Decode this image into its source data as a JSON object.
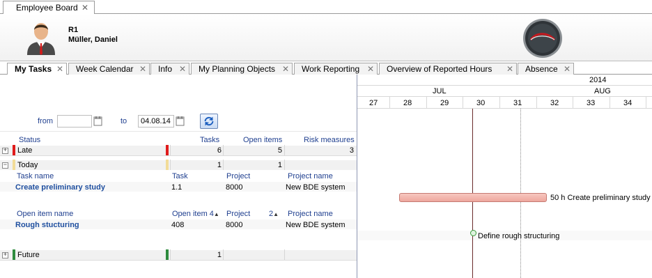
{
  "document_tab": {
    "label": "Employee Board",
    "close": "✕"
  },
  "user": {
    "code": "R1",
    "name": "Müller, Daniel"
  },
  "tabs": [
    {
      "label": "My Tasks",
      "active": true,
      "close": "✕"
    },
    {
      "label": "Week Calendar",
      "close": "✕"
    },
    {
      "label": "Info",
      "close": "✕"
    },
    {
      "label": "My Planning Objects",
      "close": "✕"
    },
    {
      "label": "Work Reporting",
      "close": "✕"
    },
    {
      "label": "Overview of Reported Hours",
      "close": "✕"
    },
    {
      "label": "Absence",
      "close": "✕"
    }
  ],
  "filter": {
    "from_label": "from",
    "from_value": "",
    "to_label": "to",
    "to_value": "04.08.14"
  },
  "summary_headers": {
    "status": "Status",
    "tasks": "Tasks",
    "open_items": "Open items",
    "risk": "Risk measures"
  },
  "groups": {
    "late": {
      "label": "Late",
      "tasks": "6",
      "open_items": "5",
      "risk": "3",
      "color": "#e01b1b",
      "expander": "+"
    },
    "today": {
      "label": "Today",
      "tasks": "1",
      "open_items": "1",
      "risk": "",
      "color": "#f2dc98",
      "expander": "−"
    },
    "future": {
      "label": "Future",
      "tasks": "1",
      "open_items": "",
      "risk": "",
      "color": "#2e8b3e",
      "expander": "+"
    }
  },
  "task_table": {
    "headers": {
      "name": "Task name",
      "task": "Task",
      "project": "Project",
      "project_name": "Project name"
    },
    "rows": [
      {
        "name": "Create preliminary study",
        "task": "1.1",
        "project": "8000",
        "project_name": "New BDE system"
      }
    ]
  },
  "open_item_table": {
    "headers": {
      "name": "Open item name",
      "item": "Open item 4",
      "project": "Project",
      "sort2": "2",
      "project_name": "Project name"
    },
    "sort_arrow": "▲",
    "rows": [
      {
        "name": "Rough stucturing",
        "item": "408",
        "project": "8000",
        "project_name": "New BDE system"
      }
    ]
  },
  "gantt": {
    "year": "2014",
    "months": [
      "JUL",
      "AUG"
    ],
    "days": [
      "27",
      "28",
      "29",
      "30",
      "31",
      "32",
      "33",
      "34"
    ],
    "bar_label": "50 h  Create preliminary study",
    "milestone_label": "Define rough structuring"
  }
}
